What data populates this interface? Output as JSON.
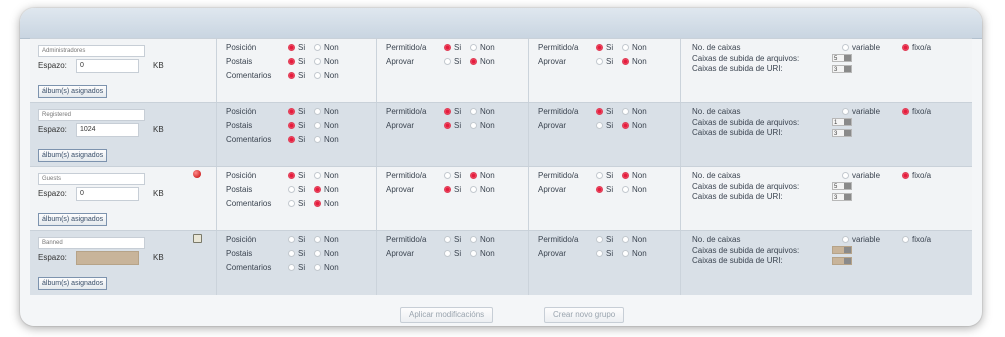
{
  "header": {
    "cells": [
      "",
      "",
      "",
      "",
      "",
      ""
    ]
  },
  "groups": [
    {
      "name": "Administradores",
      "espazo_label": "Espazo:",
      "espazo_value": "0",
      "unit": "KB",
      "album_button": "álbum(s) asignados",
      "indicator": "none",
      "posicion": {
        "label": "Posición",
        "selected": "si"
      },
      "postais": {
        "label": "Postais",
        "selected": "si"
      },
      "comentarios": {
        "label": "Comentarios",
        "selected": "si"
      },
      "perm1": {
        "label": "Permitido/a",
        "selected": "si"
      },
      "aprov1": {
        "label": "Aprovar",
        "selected": "non"
      },
      "perm2": {
        "label": "Permitido/a",
        "selected": "si"
      },
      "aprov2": {
        "label": "Aprovar",
        "selected": "non"
      },
      "no_caixas": {
        "label": "No. de caixas",
        "selected": "fixo"
      },
      "caixas_arquivos": {
        "label": "Caixas de subida de arquivos:",
        "value": "5"
      },
      "caixas_uri": {
        "label": "Caixas de subida de URI:",
        "value": "3"
      }
    },
    {
      "name": "Registered",
      "espazo_label": "Espazo:",
      "espazo_value": "1024",
      "unit": "KB",
      "album_button": "álbum(s) asignados",
      "indicator": "none",
      "posicion": {
        "label": "Posición",
        "selected": "si"
      },
      "postais": {
        "label": "Postais",
        "selected": "si"
      },
      "comentarios": {
        "label": "Comentarios",
        "selected": "si"
      },
      "perm1": {
        "label": "Permitido/a",
        "selected": "si"
      },
      "aprov1": {
        "label": "Aprovar",
        "selected": "si"
      },
      "perm2": {
        "label": "Permitido/a",
        "selected": "si"
      },
      "aprov2": {
        "label": "Aprovar",
        "selected": "non"
      },
      "no_caixas": {
        "label": "No. de caixas",
        "selected": "fixo"
      },
      "caixas_arquivos": {
        "label": "Caixas de subida de arquivos:",
        "value": "1"
      },
      "caixas_uri": {
        "label": "Caixas de subida de URI:",
        "value": "3"
      }
    },
    {
      "name": "Guests",
      "espazo_label": "Espazo:",
      "espazo_value": "0",
      "unit": "KB",
      "album_button": "álbum(s) asignados",
      "indicator": "red-dot",
      "posicion": {
        "label": "Posición",
        "selected": "si"
      },
      "postais": {
        "label": "Postais",
        "selected": "non"
      },
      "comentarios": {
        "label": "Comentarios",
        "selected": "non"
      },
      "perm1": {
        "label": "Permitido/a",
        "selected": "non"
      },
      "aprov1": {
        "label": "Aprovar",
        "selected": "si"
      },
      "perm2": {
        "label": "Permitido/a",
        "selected": "non"
      },
      "aprov2": {
        "label": "Aprovar",
        "selected": "si"
      },
      "no_caixas": {
        "label": "No. de caixas",
        "selected": "fixo"
      },
      "caixas_arquivos": {
        "label": "Caixas de subida de arquivos:",
        "value": "5"
      },
      "caixas_uri": {
        "label": "Caixas de subida de URI:",
        "value": "3"
      }
    },
    {
      "name": "Banned",
      "espazo_label": "Espazo:",
      "espazo_value": "",
      "unit": "KB",
      "album_button": "álbum(s) asignados",
      "indicator": "edit-square",
      "posicion": {
        "label": "Posición",
        "selected": "none"
      },
      "postais": {
        "label": "Postais",
        "selected": "none"
      },
      "comentarios": {
        "label": "Comentarios",
        "selected": "none"
      },
      "perm1": {
        "label": "Permitido/a",
        "selected": "none"
      },
      "aprov1": {
        "label": "Aprovar",
        "selected": "none"
      },
      "perm2": {
        "label": "Permitido/a",
        "selected": "none"
      },
      "aprov2": {
        "label": "Aprovar",
        "selected": "none"
      },
      "no_caixas": {
        "label": "No. de caixas",
        "selected": "none"
      },
      "caixas_arquivos": {
        "label": "Caixas de subida de arquivos:",
        "value": ""
      },
      "caixas_uri": {
        "label": "Caixas de subida de URI:",
        "value": ""
      }
    }
  ],
  "radio_labels": {
    "si": "Si",
    "non": "Non",
    "variable": "variable",
    "fixo": "fixo/a"
  },
  "footer": {
    "apply_button": "Aplicar modificacións",
    "create_button": "Crear novo grupo"
  },
  "colors": {
    "radio_on": "#e51c3d",
    "row_dark": "#d9e0e7",
    "row_light": "#f2f4f6"
  }
}
